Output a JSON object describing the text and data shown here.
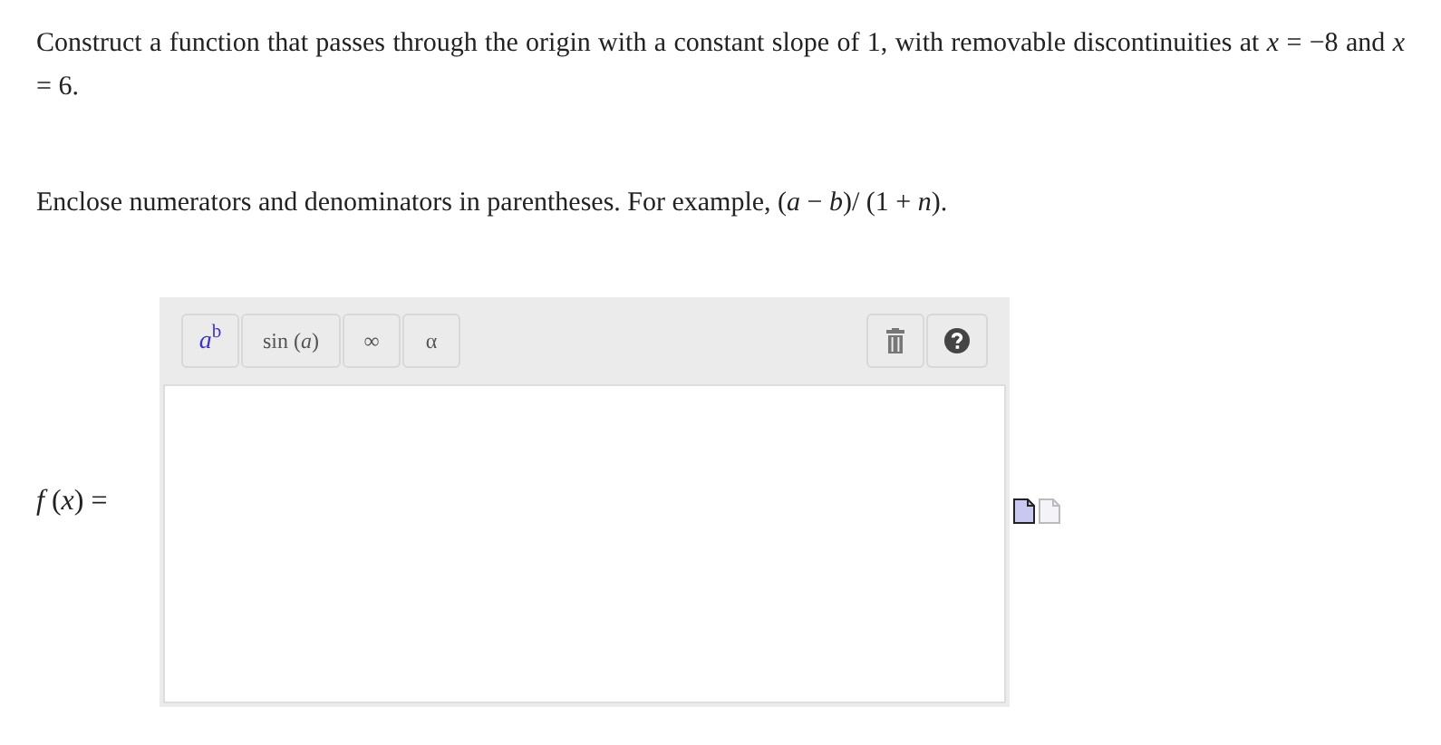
{
  "question": "Construct a function that passes through the origin with a constant slope of 1, with removable discontinuities at *x* = −8 and *x* = 6.",
  "instruction": "Enclose numerators and denominators in parentheses. For example, (*a* − *b*)/ (1 + *n*).",
  "answer_label": "*f* (*x*) =",
  "toolbar": [
    {
      "kind": "power",
      "label": "*a*$^{b}$"
    },
    {
      "kind": "function",
      "label": "sin (*a*)"
    },
    {
      "kind": "symbol",
      "label": "∞"
    },
    {
      "kind": "symbol",
      "label": "α"
    }
  ]
}
